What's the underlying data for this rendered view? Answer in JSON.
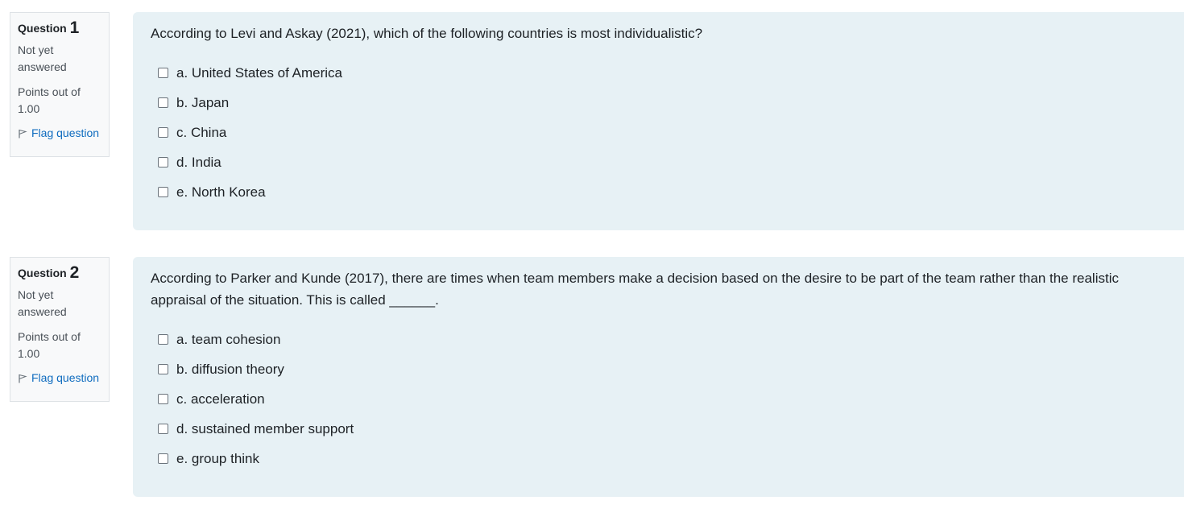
{
  "questions": [
    {
      "label": "Question",
      "number": "1",
      "state": "Not yet answered",
      "grade": "Points out of 1.00",
      "flag_label": "Flag question",
      "text": "According to Levi and Askay (2021), which of the following countries is most individualistic?",
      "options": [
        "a. United States of America",
        "b. Japan",
        "c. China",
        "d. India",
        "e. North Korea"
      ]
    },
    {
      "label": "Question",
      "number": "2",
      "state": "Not yet answered",
      "grade": "Points out of 1.00",
      "flag_label": "Flag question",
      "text": "According to Parker and Kunde (2017), there are times when team members make a decision based on the desire to be part of the team rather than the realistic appraisal of the situation. This is called ______.",
      "options": [
        "a. team cohesion",
        "b. diffusion theory",
        "c. acceleration",
        "d. sustained member support",
        "e. group think"
      ]
    }
  ],
  "colors": {
    "content_bg": "#e7f1f5",
    "info_bg": "#f8f9fa",
    "link": "#0f6cbf"
  }
}
